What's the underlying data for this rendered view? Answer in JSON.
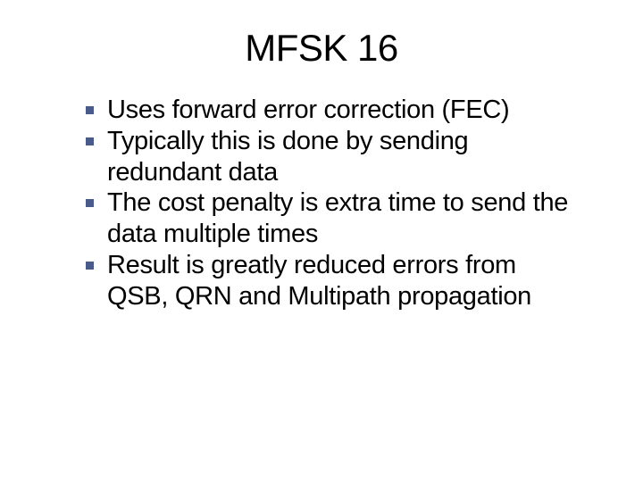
{
  "title": "MFSK 16",
  "bullets": [
    "Uses forward error correction (FEC)",
    "Typically this is done by sending redundant data",
    "The cost penalty is extra time to send the data multiple times",
    "Result is greatly reduced errors from QSB, QRN and Multipath propagation"
  ]
}
